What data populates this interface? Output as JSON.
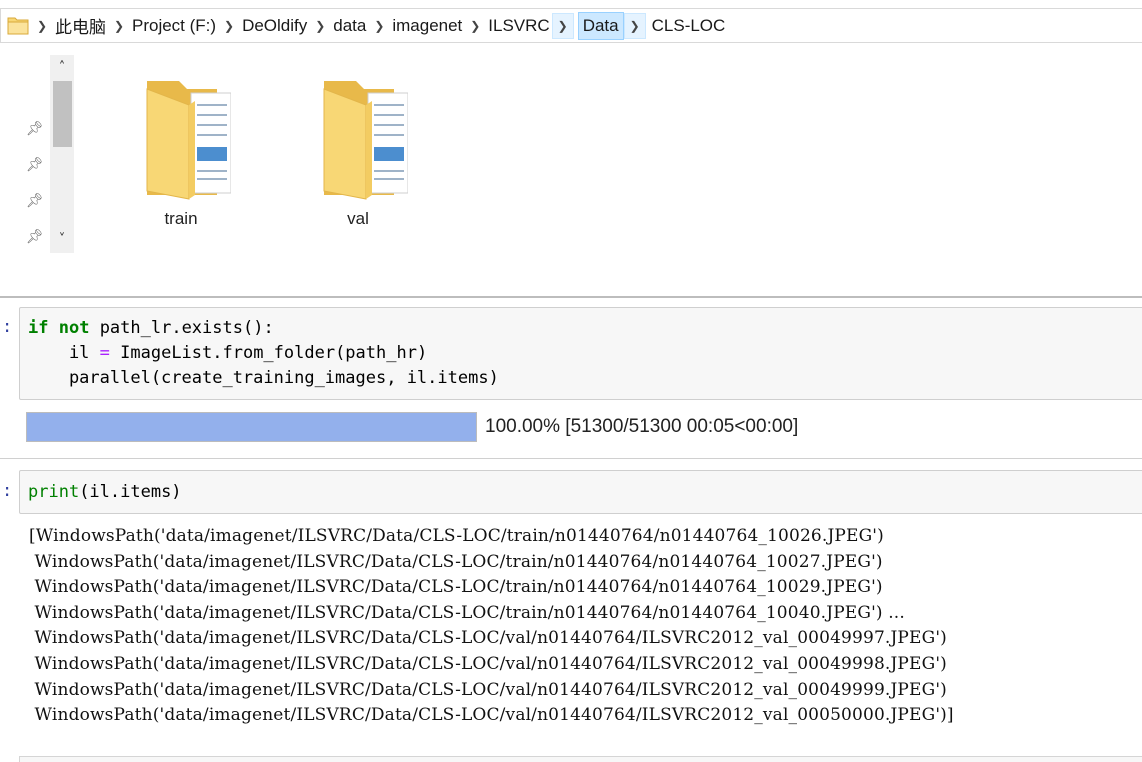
{
  "address_bar": {
    "crumbs": [
      {
        "label": "此电脑"
      },
      {
        "label": "Project (F:)"
      },
      {
        "label": "DeOldify"
      },
      {
        "label": "data"
      },
      {
        "label": "imagenet"
      },
      {
        "label": "ILSVRC"
      },
      {
        "label": "Data"
      },
      {
        "label": "CLS-LOC"
      }
    ],
    "active_index": 6
  },
  "explorer": {
    "folders": [
      {
        "name": "train",
        "icon": "folder-icon"
      },
      {
        "name": "val",
        "icon": "folder-icon"
      }
    ],
    "pin_icons": [
      "pin-icon",
      "pin-icon",
      "pin-icon",
      "pin-icon"
    ],
    "scroll_up_glyph": "˄",
    "scroll_down_glyph": "˅",
    "colors": {
      "folder": "#f8d775",
      "folder_dark": "#e8b94a",
      "selection": "#cce8ff"
    }
  },
  "cell1": {
    "prompt": ":",
    "code": {
      "line1_kw1": "if",
      "line1_kw2": "not",
      "line1_rest": " path_lr.exists():",
      "line2_indent": "    il ",
      "line2_op": "=",
      "line2_rest": " ImageList.from_folder(path_hr)",
      "line3": "    parallel(create_training_images, il.items)"
    },
    "progress": {
      "fraction": 1.0,
      "text": "100.00% [51300/51300 00:05<00:00]",
      "color": "#93b0ec"
    }
  },
  "cell2": {
    "prompt": ":",
    "code": {
      "fn": "print",
      "rest": "(il.items)"
    },
    "output_lines": [
      "[WindowsPath('data/imagenet/ILSVRC/Data/CLS-LOC/train/n01440764/n01440764_10026.JPEG')",
      " WindowsPath('data/imagenet/ILSVRC/Data/CLS-LOC/train/n01440764/n01440764_10027.JPEG')",
      " WindowsPath('data/imagenet/ILSVRC/Data/CLS-LOC/train/n01440764/n01440764_10029.JPEG')",
      " WindowsPath('data/imagenet/ILSVRC/Data/CLS-LOC/train/n01440764/n01440764_10040.JPEG') ...",
      " WindowsPath('data/imagenet/ILSVRC/Data/CLS-LOC/val/n01440764/ILSVRC2012_val_00049997.JPEG')",
      " WindowsPath('data/imagenet/ILSVRC/Data/CLS-LOC/val/n01440764/ILSVRC2012_val_00049998.JPEG')",
      " WindowsPath('data/imagenet/ILSVRC/Data/CLS-LOC/val/n01440764/ILSVRC2012_val_00049999.JPEG')",
      " WindowsPath('data/imagenet/ILSVRC/Data/CLS-LOC/val/n01440764/ILSVRC2012_val_00050000.JPEG')]"
    ]
  }
}
